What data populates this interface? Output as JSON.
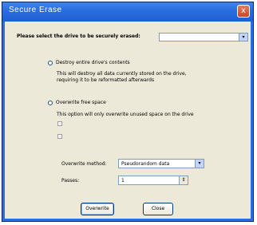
{
  "window": {
    "title": "Secure Erase",
    "close_glyph": "x"
  },
  "drive_select": {
    "label": "Please select the drive to be securely erased:",
    "value": "",
    "arrow_glyph": "▾"
  },
  "options": {
    "destroy": {
      "label": "Destroy entire drive's contents",
      "description": [
        "This will destroy all data currently stored on the drive,",
        "requiring it to be reformatted afterwards"
      ],
      "selected": false
    },
    "overwrite": {
      "label": "Overwrite free space",
      "description": "This option will only overwrite unused space on the drive",
      "selected": false
    }
  },
  "method": {
    "label": "Overwrite method:",
    "value": "Pseudorandom data",
    "arrow_glyph": "▾"
  },
  "passes": {
    "label": "Passes:",
    "value": "1",
    "spin_glyph": "⇕"
  },
  "buttons": {
    "overwrite": "Overwrite",
    "close": "Close"
  },
  "colors": {
    "titlebar": "#2a6fe0",
    "dialog_bg": "#ece9d8"
  }
}
